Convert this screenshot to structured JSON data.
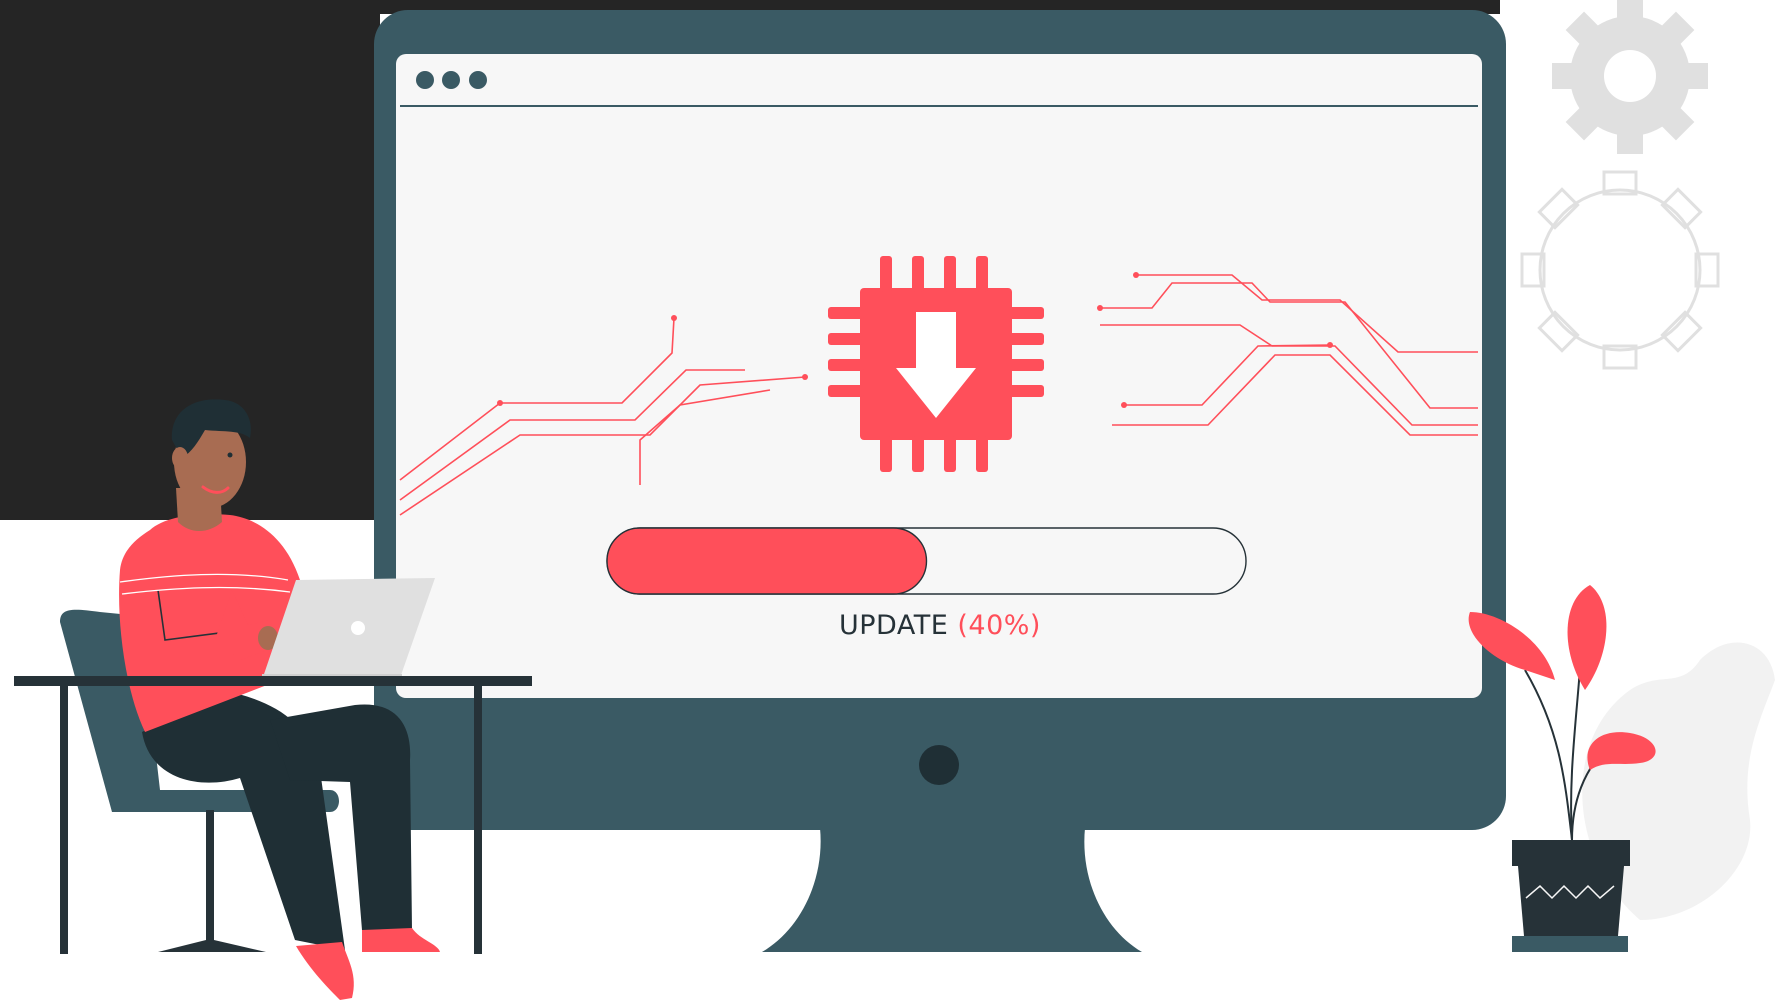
{
  "screen": {
    "status_label": "UPDATE",
    "progress_text": "(40%)",
    "progress": 0.5
  },
  "colors": {
    "accent": "#ff4f5a",
    "dark": "#263238",
    "monitor": "#3a5a64",
    "screen": "#f7f7f7",
    "black_panel": "#252525",
    "gear": "#e0e0e0"
  },
  "icons": [
    "chip-download-icon",
    "gear-icon",
    "gear-outline-icon",
    "window-dots-icon",
    "laptop-icon"
  ]
}
